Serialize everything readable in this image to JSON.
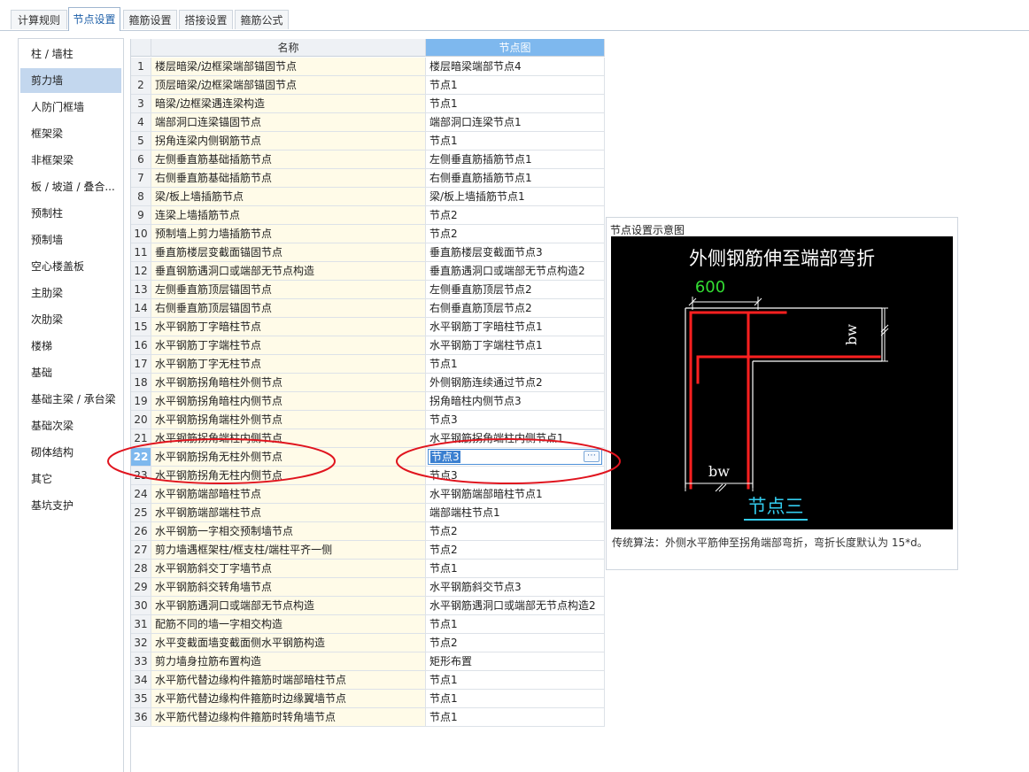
{
  "tabs": [
    {
      "label": "计算规则",
      "active": false
    },
    {
      "label": "节点设置",
      "active": true
    },
    {
      "label": "箍筋设置",
      "active": false
    },
    {
      "label": "搭接设置",
      "active": false
    },
    {
      "label": "箍筋公式",
      "active": false
    }
  ],
  "sidebar": {
    "selected": "剪力墙",
    "items": [
      "柱 / 墙柱",
      "剪力墙",
      "人防门框墙",
      "框架梁",
      "非框架梁",
      "板 / 坡道 / 叠合...",
      "预制柱",
      "预制墙",
      "空心楼盖板",
      "主肋梁",
      "次肋梁",
      "楼梯",
      "基础",
      "基础主梁 / 承台梁",
      "基础次梁",
      "砌体结构",
      "其它",
      "基坑支护"
    ]
  },
  "grid": {
    "headers": {
      "index": "",
      "name": "名称",
      "node": "节点图"
    },
    "selected_row": 22,
    "editing_value": "节点3",
    "rows": [
      {
        "idx": "1",
        "name": "楼层暗梁/边框梁端部锚固节点",
        "node": "楼层暗梁端部节点4"
      },
      {
        "idx": "2",
        "name": "顶层暗梁/边框梁端部锚固节点",
        "node": "节点1"
      },
      {
        "idx": "3",
        "name": "暗梁/边框梁遇连梁构造",
        "node": "节点1"
      },
      {
        "idx": "4",
        "name": "端部洞口连梁锚固节点",
        "node": "端部洞口连梁节点1"
      },
      {
        "idx": "5",
        "name": "拐角连梁内侧钢筋节点",
        "node": "节点1"
      },
      {
        "idx": "6",
        "name": "左侧垂直筋基础插筋节点",
        "node": "左侧垂直筋插筋节点1"
      },
      {
        "idx": "7",
        "name": "右侧垂直筋基础插筋节点",
        "node": "右侧垂直筋插筋节点1"
      },
      {
        "idx": "8",
        "name": "梁/板上墙插筋节点",
        "node": "梁/板上墙插筋节点1"
      },
      {
        "idx": "9",
        "name": "连梁上墙插筋节点",
        "node": "节点2"
      },
      {
        "idx": "10",
        "name": "预制墙上剪力墙插筋节点",
        "node": "节点2"
      },
      {
        "idx": "11",
        "name": "垂直筋楼层变截面锚固节点",
        "node": "垂直筋楼层变截面节点3"
      },
      {
        "idx": "12",
        "name": "垂直钢筋遇洞口或端部无节点构造",
        "node": "垂直筋遇洞口或端部无节点构造2"
      },
      {
        "idx": "13",
        "name": "左侧垂直筋顶层锚固节点",
        "node": "左侧垂直筋顶层节点2"
      },
      {
        "idx": "14",
        "name": "右侧垂直筋顶层锚固节点",
        "node": "右侧垂直筋顶层节点2"
      },
      {
        "idx": "15",
        "name": "水平钢筋丁字暗柱节点",
        "node": "水平钢筋丁字暗柱节点1"
      },
      {
        "idx": "16",
        "name": "水平钢筋丁字端柱节点",
        "node": "水平钢筋丁字端柱节点1"
      },
      {
        "idx": "17",
        "name": "水平钢筋丁字无柱节点",
        "node": "节点1"
      },
      {
        "idx": "18",
        "name": "水平钢筋拐角暗柱外侧节点",
        "node": "外侧钢筋连续通过节点2"
      },
      {
        "idx": "19",
        "name": "水平钢筋拐角暗柱内侧节点",
        "node": "拐角暗柱内侧节点3"
      },
      {
        "idx": "20",
        "name": "水平钢筋拐角端柱外侧节点",
        "node": "节点3"
      },
      {
        "idx": "21",
        "name": "水平钢筋拐角端柱内侧节点",
        "node": "水平钢筋拐角端柱内侧节点1"
      },
      {
        "idx": "22",
        "name": "水平钢筋拐角无柱外侧节点",
        "node": "节点3"
      },
      {
        "idx": "23",
        "name": "水平钢筋拐角无柱内侧节点",
        "node": "节点3"
      },
      {
        "idx": "24",
        "name": "水平钢筋端部暗柱节点",
        "node": "水平钢筋端部暗柱节点1"
      },
      {
        "idx": "25",
        "name": "水平钢筋端部端柱节点",
        "node": "端部端柱节点1"
      },
      {
        "idx": "26",
        "name": "水平钢筋一字相交预制墙节点",
        "node": "节点2"
      },
      {
        "idx": "27",
        "name": "剪力墙遇框架柱/框支柱/端柱平齐一侧",
        "node": "节点2"
      },
      {
        "idx": "28",
        "name": "水平钢筋斜交丁字墙节点",
        "node": "节点1"
      },
      {
        "idx": "29",
        "name": "水平钢筋斜交转角墙节点",
        "node": "水平钢筋斜交节点3"
      },
      {
        "idx": "30",
        "name": "水平钢筋遇洞口或端部无节点构造",
        "node": "水平钢筋遇洞口或端部无节点构造2"
      },
      {
        "idx": "31",
        "name": "配筋不同的墙一字相交构造",
        "node": "节点1"
      },
      {
        "idx": "32",
        "name": "水平变截面墙变截面侧水平钢筋构造",
        "node": "节点2"
      },
      {
        "idx": "33",
        "name": "剪力墙身拉筋布置构造",
        "node": "矩形布置"
      },
      {
        "idx": "34",
        "name": "水平筋代替边缘构件箍筋时端部暗柱节点",
        "node": "节点1"
      },
      {
        "idx": "35",
        "name": "水平筋代替边缘构件箍筋时边缘翼墙节点",
        "node": "节点1"
      },
      {
        "idx": "36",
        "name": "水平筋代替边缘构件箍筋时转角墙节点",
        "node": "节点1"
      }
    ]
  },
  "preview": {
    "title": "节点设置示意图",
    "diagram_heading": "外侧钢筋伸至端部弯折",
    "dim_top": "600",
    "dim_side": "bw",
    "dim_bottom": "bw",
    "node_caption": "节点三",
    "description": "传统算法：外侧水平筋伸至拐角端部弯折，弯折长度默认为 15*d。"
  },
  "colors": {
    "tab_active_text": "#1d5fa8",
    "selection": "#c3d7ee",
    "header_accent": "#7eb8ee",
    "name_cell_bg": "#fffbe8",
    "rebar_red": "#ff2020",
    "dim_green": "#33dd33",
    "caption_cyan": "#33ccee",
    "annotation_ellipse": "#e0141e"
  }
}
